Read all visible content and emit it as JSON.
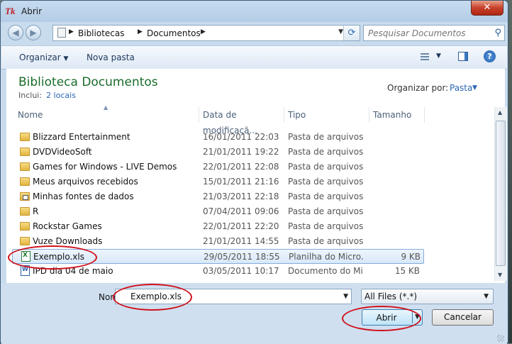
{
  "window": {
    "title": "Abrir",
    "app_icon_text": "Tk",
    "close_symbol": "✕"
  },
  "nav": {
    "back_symbol": "◀",
    "forward_symbol": "▶",
    "breadcrumb": [
      "Bibliotecas",
      "Documentos"
    ],
    "search_placeholder": "Pesquisar Documentos"
  },
  "toolbar": {
    "organize_label": "Organizar",
    "new_folder_label": "Nova pasta"
  },
  "library": {
    "title": "Biblioteca Documentos",
    "includes_label": "Inclui:",
    "includes_link": "2 locais",
    "arrange_label": "Organizar por:",
    "arrange_value": "Pasta"
  },
  "columns": [
    "Nome",
    "Data de modificaçã...",
    "Tipo",
    "Tamanho"
  ],
  "files": [
    {
      "name": "Blizzard Entertainment",
      "date": "16/01/2011 22:03",
      "type": "Pasta de arquivos",
      "size": "",
      "icon": "folder-icon"
    },
    {
      "name": "DVDVideoSoft",
      "date": "21/01/2011 19:22",
      "type": "Pasta de arquivos",
      "size": "",
      "icon": "folder-icon"
    },
    {
      "name": "Games for Windows - LIVE Demos",
      "date": "22/01/2011 22:08",
      "type": "Pasta de arquivos",
      "size": "",
      "icon": "folder-icon"
    },
    {
      "name": "Meus arquivos recebidos",
      "date": "15/01/2011 21:16",
      "type": "Pasta de arquivos",
      "size": "",
      "icon": "folder-icon"
    },
    {
      "name": "Minhas fontes de dados",
      "date": "21/03/2011 22:18",
      "type": "Pasta de arquivos",
      "size": "",
      "icon": "special-folder-icon"
    },
    {
      "name": "R",
      "date": "07/04/2011 09:06",
      "type": "Pasta de arquivos",
      "size": "",
      "icon": "folder-icon"
    },
    {
      "name": "Rockstar Games",
      "date": "22/01/2011 22:20",
      "type": "Pasta de arquivos",
      "size": "",
      "icon": "folder-icon"
    },
    {
      "name": "Vuze Downloads",
      "date": "21/01/2011 14:55",
      "type": "Pasta de arquivos",
      "size": "",
      "icon": "folder-icon"
    },
    {
      "name": "Exemplo.xls",
      "date": "29/05/2011 18:55",
      "type": "Planilha do Micro...",
      "size": "9 KB",
      "icon": "excel-file-icon",
      "selected": true
    },
    {
      "name": "IPD dia 04 de maio",
      "date": "03/05/2011 10:17",
      "type": "Documento do Mi...",
      "size": "15 KB",
      "icon": "word-file-icon"
    }
  ],
  "footer": {
    "filename_label": "Nome:",
    "filename_value": "Exemplo.xls",
    "filter_value": "All Files (*.*)",
    "open_label": "Abrir",
    "cancel_label": "Cancelar"
  },
  "colors": {
    "annotation_ring": "#d0101a",
    "library_title": "#1a6b2a",
    "link": "#2a66b5",
    "selection": "#d8e8f9"
  }
}
